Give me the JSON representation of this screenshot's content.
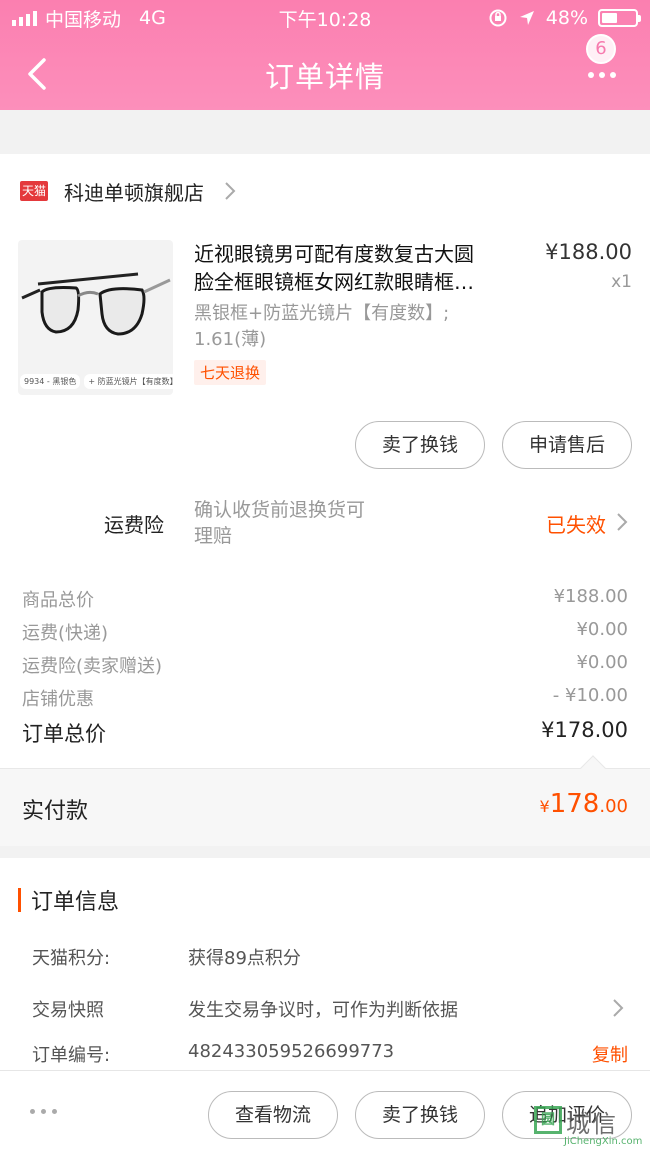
{
  "status_bar": {
    "carrier": "中国移动",
    "network": "4G",
    "time": "下午10:28",
    "battery": "48%",
    "battery_level": 0.48
  },
  "nav": {
    "title": "订单详情",
    "badge_count": "6",
    "back_icon": "chevron-left-icon",
    "more_icon": "more-dots-icon"
  },
  "store": {
    "logo_text": "天猫",
    "name": "科迪单顿旗舰店"
  },
  "product": {
    "title_line1": "近视眼镜男可配有度数复古大圆",
    "title_line2": "脸全框眼镜框女网红款眼睛框…",
    "price": "¥188.00",
    "qty": "x1",
    "spec_line1": "黑银框+防蓝光镜片【有度数】;",
    "spec_line2": "1.61(薄)",
    "tag": "七天退换",
    "thumb_caption_left": "9934 - 黑银色",
    "thumb_caption_right": "+ 防蓝光镜片【有度数】"
  },
  "item_actions": {
    "sell_exchange": "卖了换钱",
    "after_sale": "申请售后"
  },
  "insurance": {
    "label": "运费险",
    "desc_line1": "确认收货前退换货可",
    "desc_line2": "理赔",
    "status": "已失效"
  },
  "summary": {
    "rows": [
      {
        "label": "商品总价",
        "value": "¥188.00"
      },
      {
        "label": "运费(快递)",
        "value": "¥0.00"
      },
      {
        "label": "运费险(卖家赠送)",
        "value": "¥0.00"
      },
      {
        "label": "店铺优惠",
        "value": "- ¥10.00"
      }
    ],
    "total_label": "订单总价",
    "total_value": "¥178.00",
    "paid_label": "实付款",
    "paid_currency": "¥",
    "paid_int": "178",
    "paid_dec": ".00"
  },
  "order_info": {
    "title": "订单信息",
    "points_label": "天猫积分:",
    "points_value": "获得89点积分",
    "snapshot_label": "交易快照",
    "snapshot_value": "发生交易争议时，可作为判断依据",
    "order_no_label": "订单编号:",
    "order_no_value": "482433059526699773",
    "copy_label": "复制"
  },
  "bottom_bar": {
    "logistics": "查看物流",
    "sell_exchange": "卖了换钱",
    "add_review": "追加评价"
  },
  "watermark": {
    "mark": "圆",
    "text": "城信",
    "url": "JiChengXin.com"
  },
  "colors": {
    "header_pink": "#fb7fb0",
    "accent_orange": "#ff5000"
  }
}
